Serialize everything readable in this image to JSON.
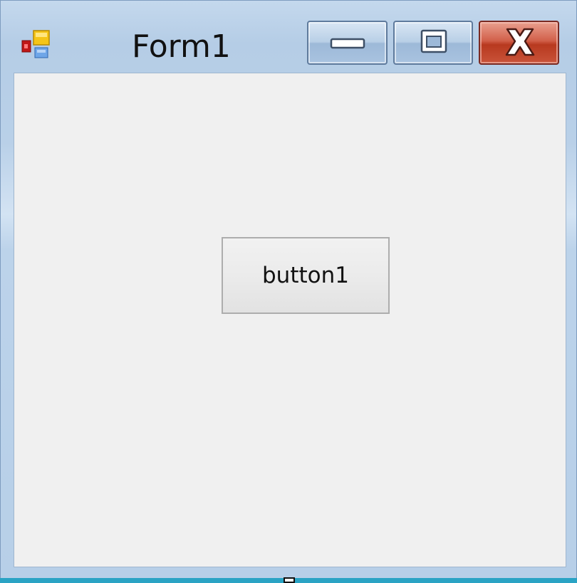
{
  "window": {
    "title": "Form1",
    "icon": "windows-forms-app-icon"
  },
  "caption_buttons": {
    "minimize_icon": "minimize-icon",
    "maximize_icon": "maximize-icon",
    "close_icon": "close-icon"
  },
  "form": {
    "button1_label": "button1"
  },
  "colors": {
    "client_background": "#f0f0f0",
    "close_button": "#c9543a",
    "titlebar": "#b9d0e8"
  }
}
